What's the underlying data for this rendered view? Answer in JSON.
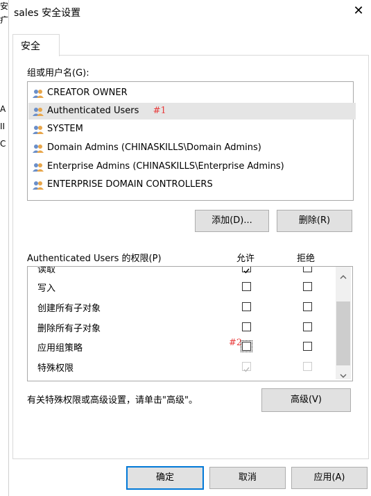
{
  "window": {
    "title": "sales 安全设置",
    "close_glyph": "✕"
  },
  "background_chars": [
    "安",
    "疒",
    "A",
    "II",
    "C"
  ],
  "tab": {
    "label": "安全"
  },
  "users": {
    "label": "组或用户名(G):",
    "items": [
      {
        "name": "CREATOR OWNER",
        "selected": false
      },
      {
        "name": "Authenticated Users",
        "selected": true
      },
      {
        "name": "SYSTEM",
        "selected": false
      },
      {
        "name": "Domain Admins (CHINASKILLS\\Domain Admins)",
        "selected": false
      },
      {
        "name": "Enterprise Admins (CHINASKILLS\\Enterprise Admins)",
        "selected": false
      },
      {
        "name": "ENTERPRISE DOMAIN CONTROLLERS",
        "selected": false
      }
    ],
    "annotation": "#1"
  },
  "buttons": {
    "add": "添加(D)...",
    "remove": "删除(R)",
    "advanced": "高级(V)",
    "ok": "确定",
    "cancel": "取消",
    "apply": "应用(A)"
  },
  "permissions": {
    "header": "Authenticated Users 的权限(P)",
    "allow_header": "允许",
    "deny_header": "拒绝",
    "rows": [
      {
        "name": "读取",
        "allow": true,
        "deny": false
      },
      {
        "name": "写入",
        "allow": false,
        "deny": false
      },
      {
        "name": "创建所有子对象",
        "allow": false,
        "deny": false
      },
      {
        "name": "删除所有子对象",
        "allow": false,
        "deny": false
      },
      {
        "name": "应用组策略",
        "allow": false,
        "deny": false
      },
      {
        "name": "特殊权限",
        "allow": true,
        "deny": false,
        "disabled": true
      }
    ],
    "annotation": "#2"
  },
  "advanced_hint": "有关特殊权限或高级设置，请单击\"高级\"。",
  "colors": {
    "accent": "#0078d7",
    "annotation": "#e83a3a",
    "selection": "#e5e5e5"
  }
}
